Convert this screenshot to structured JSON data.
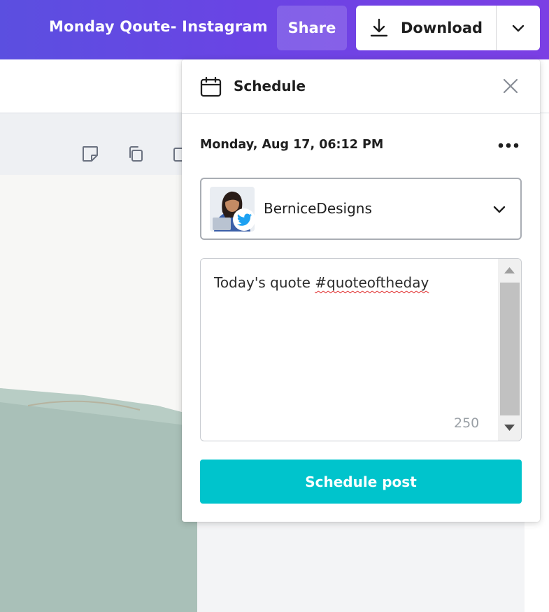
{
  "topbar": {
    "title": "Monday Qoute- Instagram",
    "share_label": "Share",
    "download_label": "Download",
    "icons": [
      "download-icon",
      "chevron-down-icon"
    ]
  },
  "canvas_toolbar": {
    "icons": [
      "sticky-note-icon",
      "duplicate-icon",
      "add-page-icon"
    ]
  },
  "schedule_panel": {
    "title": "Schedule",
    "datetime": "Monday, Aug 17, 06:12 PM",
    "account": {
      "name": "BerniceDesigns",
      "network": "twitter"
    },
    "caption": {
      "text_plain": "Today's quote ",
      "hashtag": "#quoteoftheday",
      "char_count": "250"
    },
    "submit_label": "Schedule post"
  },
  "colors": {
    "topbar_gradient_start": "#5b4fe0",
    "topbar_gradient_end": "#7b3fe4",
    "accent_teal": "#00c4cc",
    "twitter_blue": "#1da1f2",
    "spellcheck_red": "#e02b2b"
  }
}
